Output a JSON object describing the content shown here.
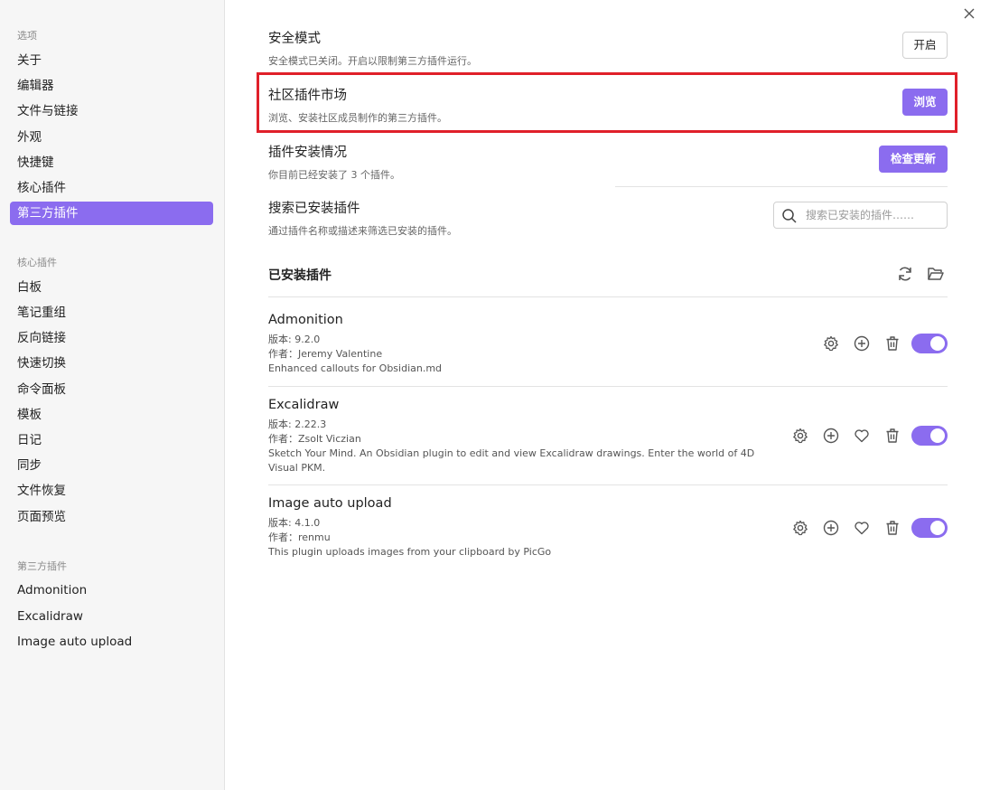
{
  "sidebar": {
    "groups": [
      {
        "title": "选项",
        "items": [
          "关于",
          "编辑器",
          "文件与链接",
          "外观",
          "快捷键",
          "核心插件",
          "第三方插件"
        ]
      },
      {
        "title": "核心插件",
        "items": [
          "白板",
          "笔记重组",
          "反向链接",
          "快速切换",
          "命令面板",
          "模板",
          "日记",
          "同步",
          "文件恢复",
          "页面预览"
        ]
      },
      {
        "title": "第三方插件",
        "items": [
          "Admonition",
          "Excalidraw",
          "Image auto upload"
        ]
      }
    ],
    "active_item": "第三方插件"
  },
  "settings": {
    "safe_mode": {
      "title": "安全模式",
      "desc": "安全模式已关闭。开启以限制第三方插件运行。",
      "button": "开启"
    },
    "community": {
      "title": "社区插件市场",
      "desc": "浏览、安装社区成员制作的第三方插件。",
      "button": "浏览"
    },
    "installed_status": {
      "title": "插件安装情况",
      "desc": "你目前已经安装了 3 个插件。",
      "button": "检查更新"
    },
    "search_installed": {
      "title": "搜索已安装插件",
      "desc": "通过插件名称或描述来筛选已安装的插件。",
      "placeholder": "搜索已安装的插件……"
    }
  },
  "installed": {
    "title": "已安装插件",
    "plugins": [
      {
        "name": "Admonition",
        "version": "版本: 9.2.0",
        "author": "作者：Jeremy Valentine",
        "desc": "Enhanced callouts for Obsidian.md",
        "enabled": true
      },
      {
        "name": "Excalidraw",
        "version": "版本: 2.22.3",
        "author": "作者：Zsolt Viczian",
        "desc": "Sketch Your Mind. An Obsidian plugin to edit and view Excalidraw drawings. Enter the world of 4D Visual PKM.",
        "enabled": true
      },
      {
        "name": "Image auto upload",
        "version": "版本: 4.1.0",
        "author": "作者：renmu",
        "desc": "This plugin uploads images from your clipboard by PicGo",
        "enabled": true
      }
    ]
  },
  "colors": {
    "accent": "#8b6cef",
    "highlight": "#e0202a"
  }
}
